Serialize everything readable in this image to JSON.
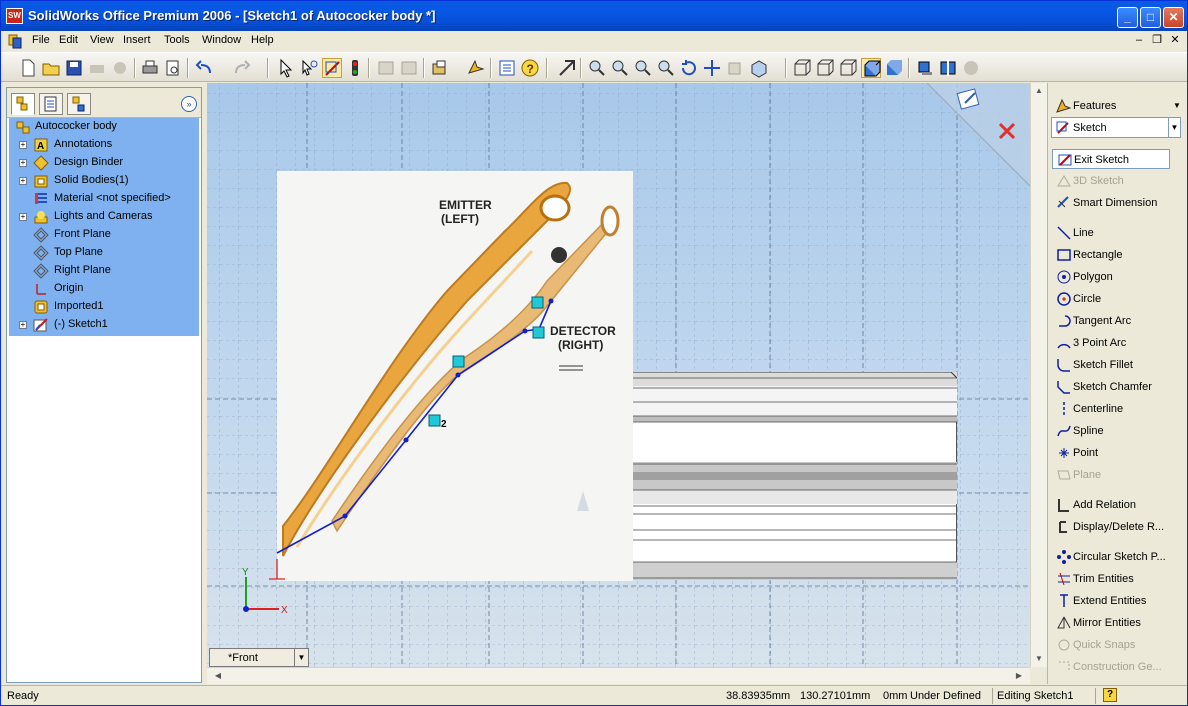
{
  "window": {
    "title": "SolidWorks Office Premium 2006 - [Sketch1 of Autococker body *]",
    "app_icon_text": "SW"
  },
  "menubar": {
    "items": [
      "File",
      "Edit",
      "View",
      "Insert",
      "Tools",
      "Window",
      "Help"
    ]
  },
  "feature_tree": {
    "root": "Autococker body",
    "items": [
      {
        "label": "Annotations",
        "icon": "annotations-icon",
        "expandable": true
      },
      {
        "label": "Design Binder",
        "icon": "design-binder-icon",
        "expandable": true
      },
      {
        "label": "Solid Bodies(1)",
        "icon": "solid-bodies-icon",
        "expandable": true
      },
      {
        "label": "Material <not specified>",
        "icon": "material-icon",
        "expandable": false
      },
      {
        "label": "Lights and Cameras",
        "icon": "lights-icon",
        "expandable": true
      },
      {
        "label": "Front Plane",
        "icon": "plane-icon",
        "expandable": false
      },
      {
        "label": "Top Plane",
        "icon": "plane-icon",
        "expandable": false
      },
      {
        "label": "Right Plane",
        "icon": "plane-icon",
        "expandable": false
      },
      {
        "label": "Origin",
        "icon": "origin-icon",
        "expandable": false
      },
      {
        "label": "Imported1",
        "icon": "imported-icon",
        "expandable": false
      },
      {
        "label": "(-) Sketch1",
        "icon": "sketch-icon",
        "expandable": true
      }
    ]
  },
  "graphics": {
    "photo_label_1a": "EMITTER",
    "photo_label_1b": "(LEFT)",
    "photo_label_2a": "DETECTOR",
    "photo_label_2b": "(RIGHT)",
    "dimension_label": "2",
    "axis_x": "X",
    "axis_y": "Y",
    "view_name": "*Front"
  },
  "command_manager": {
    "features_tab": "Features",
    "sketch_select": "Sketch",
    "items": [
      {
        "label": "Exit Sketch",
        "enabled": true,
        "icon": "exit-sketch-icon"
      },
      {
        "label": "3D Sketch",
        "enabled": false,
        "icon": "3d-sketch-icon"
      },
      {
        "label": "Smart Dimension",
        "enabled": true,
        "icon": "smart-dimension-icon"
      },
      {
        "label": "Line",
        "enabled": true,
        "icon": "line-icon"
      },
      {
        "label": "Rectangle",
        "enabled": true,
        "icon": "rectangle-icon"
      },
      {
        "label": "Polygon",
        "enabled": true,
        "icon": "polygon-icon"
      },
      {
        "label": "Circle",
        "enabled": true,
        "icon": "circle-icon"
      },
      {
        "label": "Tangent Arc",
        "enabled": true,
        "icon": "tangent-arc-icon"
      },
      {
        "label": "3 Point Arc",
        "enabled": true,
        "icon": "3-point-arc-icon"
      },
      {
        "label": "Sketch Fillet",
        "enabled": true,
        "icon": "sketch-fillet-icon"
      },
      {
        "label": "Sketch Chamfer",
        "enabled": true,
        "icon": "sketch-chamfer-icon"
      },
      {
        "label": "Centerline",
        "enabled": true,
        "icon": "centerline-icon"
      },
      {
        "label": "Spline",
        "enabled": true,
        "icon": "spline-icon"
      },
      {
        "label": "Point",
        "enabled": true,
        "icon": "point-icon"
      },
      {
        "label": "Plane",
        "enabled": false,
        "icon": "plane-icon"
      },
      {
        "label": "Add Relation",
        "enabled": true,
        "icon": "add-relation-icon"
      },
      {
        "label": "Display/Delete R...",
        "enabled": true,
        "icon": "display-delete-relations-icon"
      },
      {
        "label": "Circular Sketch P...",
        "enabled": true,
        "icon": "circular-pattern-icon"
      },
      {
        "label": "Trim Entities",
        "enabled": true,
        "icon": "trim-icon"
      },
      {
        "label": "Extend Entities",
        "enabled": true,
        "icon": "extend-icon"
      },
      {
        "label": "Mirror Entities",
        "enabled": true,
        "icon": "mirror-icon"
      },
      {
        "label": "Quick Snaps",
        "enabled": false,
        "icon": "quick-snaps-icon"
      },
      {
        "label": "Construction Ge...",
        "enabled": false,
        "icon": "construction-geometry-icon"
      }
    ]
  },
  "statusbar": {
    "status": "Ready",
    "x_coord": "38.83935mm",
    "y_coord": "130.27101mm",
    "z_coord": "0mm",
    "definition": "Under Defined",
    "editing": "Editing Sketch1",
    "help": "?"
  }
}
